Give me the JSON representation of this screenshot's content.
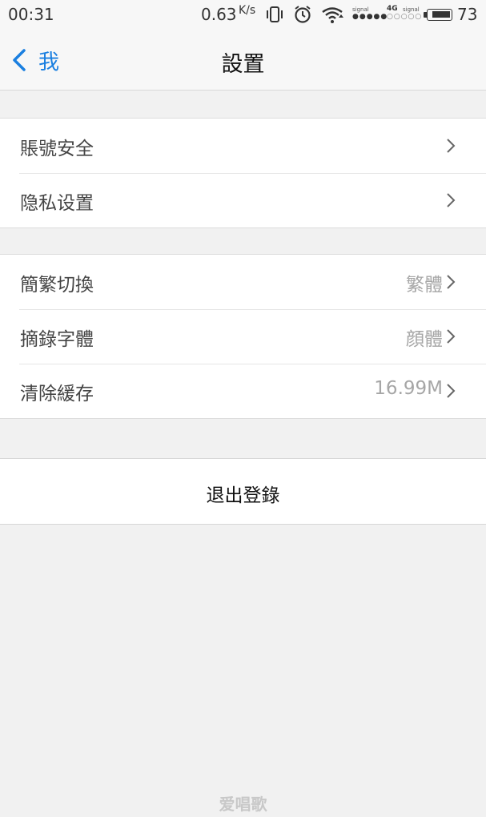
{
  "status_bar": {
    "time": "00:31",
    "speed_value": "0.63",
    "speed_unit": "K/s",
    "signal_label_1": "signal",
    "network_type": "4G",
    "signal_label_2": "signal",
    "battery_level": "73",
    "icons": [
      "vibrate-icon",
      "alarm-icon",
      "wifi-icon",
      "signal-icon",
      "battery-icon"
    ]
  },
  "nav": {
    "back_label": "我",
    "title": "設置"
  },
  "groups": [
    {
      "items": [
        {
          "label": "賬號安全",
          "value": ""
        },
        {
          "label": "隐私设置",
          "value": ""
        }
      ]
    },
    {
      "items": [
        {
          "label": "簡繁切換",
          "value": "繁體"
        },
        {
          "label": "摘錄字體",
          "value": "顔體"
        },
        {
          "label": "清除緩存",
          "value": "16.99M"
        }
      ]
    }
  ],
  "logout_label": "退出登錄",
  "watermark": "爱唱歌",
  "colors": {
    "accent": "#1a7fe0",
    "background": "#f1f1f1",
    "secondary_text": "#a6a6a6"
  }
}
